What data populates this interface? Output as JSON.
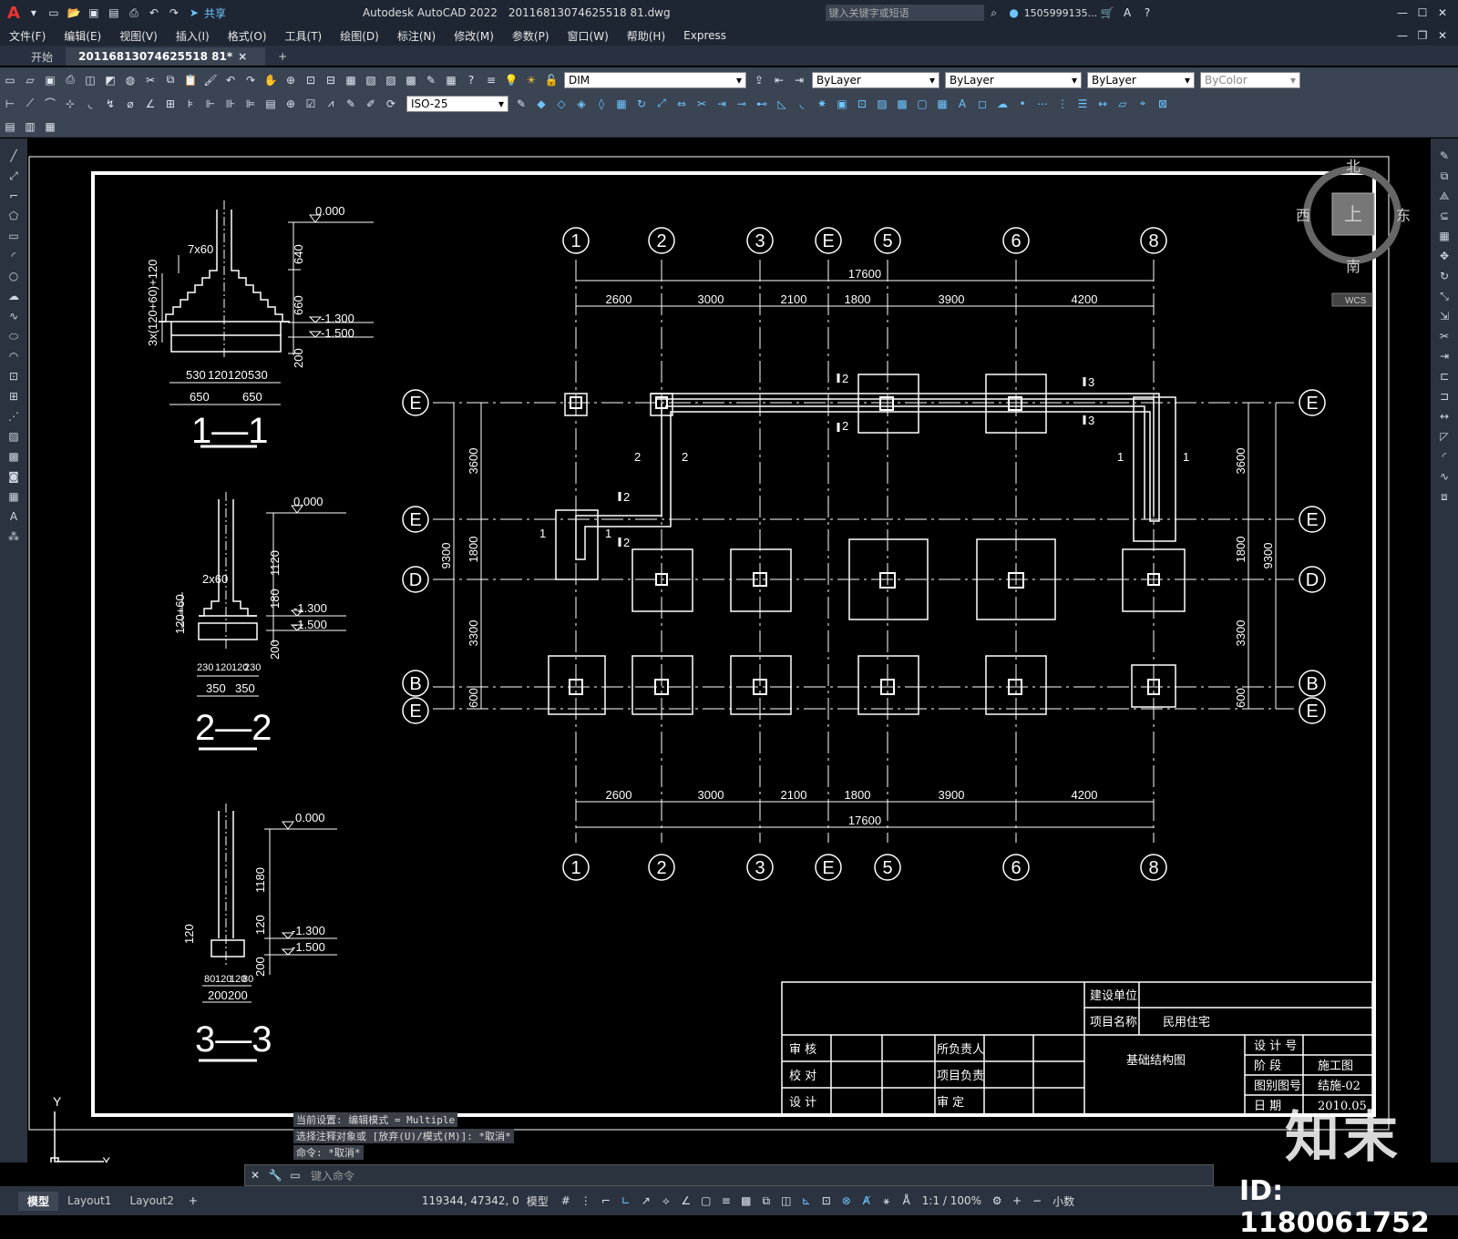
{
  "window": {
    "app_logo": "A",
    "title": "Autodesk AutoCAD 2022",
    "filename": "20116813074625518 81.dwg",
    "share_label": "共享",
    "search_placeholder": "键入关键字或短语",
    "user": "1505999135...",
    "colors": {
      "chrome": "#1e2633",
      "toolbar": "#3b4453",
      "canvas": "#000000"
    }
  },
  "menu": [
    "文件(F)",
    "编辑(E)",
    "视图(V)",
    "插入(I)",
    "格式(O)",
    "工具(T)",
    "绘图(D)",
    "标注(N)",
    "修改(M)",
    "参数(P)",
    "窗口(W)",
    "帮助(H)",
    "Express"
  ],
  "tabs": {
    "start": "开始",
    "doc": "20116813074625518 81*",
    "add": "+"
  },
  "toolbar": {
    "layer": "DIM",
    "color": "ByLayer",
    "linetype": "ByLayer",
    "lineweight": "ByLayer",
    "plotstyle": "ByColor",
    "dimstyle": "ISO-25"
  },
  "viewcube": {
    "north": "北",
    "south": "南",
    "east": "东",
    "west": "西",
    "top": "上",
    "wcs": "WCS"
  },
  "sections": [
    {
      "id": "1-1",
      "title": "1—1",
      "top_level": "0.000",
      "l1": "-1.300",
      "l2": "-1.500",
      "h1": "640",
      "h2": "660",
      "h3": "200",
      "step": "7x60",
      "side": "3x(120+60)+120",
      "w": [
        "530",
        "120",
        "120",
        "530"
      ],
      "half": [
        "650",
        "650"
      ]
    },
    {
      "id": "2-2",
      "title": "2—2",
      "top_level": "0.000",
      "l1": "-1.300",
      "l2": "-1.500",
      "h1": "1120",
      "h2": "180",
      "h3": "200",
      "step": "2x60",
      "side": "120+60",
      "w": [
        "230",
        "120",
        "120",
        "230"
      ],
      "half": [
        "350",
        "350"
      ]
    },
    {
      "id": "3-3",
      "title": "3—3",
      "top_level": "0.000",
      "l1": "-1.300",
      "l2": "-1.500",
      "h1": "1180",
      "h2": "120",
      "h3": "200",
      "side": "120",
      "w": [
        "80",
        "120",
        "120",
        "80"
      ],
      "half": [
        "200",
        "200"
      ]
    }
  ],
  "plan": {
    "axes_x": [
      "1",
      "2",
      "3",
      "E",
      "5",
      "6",
      "8"
    ],
    "axes_y": [
      "E",
      "E",
      "D",
      "B",
      "E"
    ],
    "dims_x": [
      "2600",
      "3000",
      "2100",
      "1800",
      "3900",
      "4200"
    ],
    "total_x": "17600",
    "dims_y_left": [
      "3600",
      "1800",
      "3300",
      "600"
    ],
    "total_y": "9300",
    "cut_labels": [
      "1",
      "2",
      "3"
    ]
  },
  "titleblock": {
    "jsdw": "建设单位",
    "xmmc": "项目名称",
    "xmmc_val": "民用住宅",
    "sh": "审 核",
    "jd": "校 对",
    "sj": "设 计",
    "sfzr": "所负责人",
    "xmfz": "项目负责",
    "sd": "审 定",
    "drawing_name": "基础结构图",
    "sjh": "设 计 号",
    "jieduan": "阶 段",
    "jieduan_val": "施工图",
    "tbth": "图别图号",
    "tbth_val": "结施-02",
    "riqi": "日 期",
    "riqi_val": "2010.05"
  },
  "ucs": {
    "x": "X",
    "y": "Y"
  },
  "command": {
    "line1": "当前设置: 编辑模式 = Multiple",
    "line2": "选择注释对象或 [放弃(U)/模式(M)]: *取消*",
    "line3": "命令: *取消*",
    "placeholder": "键入命令"
  },
  "status": {
    "tabs": [
      "模型",
      "Layout1",
      "Layout2"
    ],
    "coords": "119344, 47342, 0",
    "model": "模型",
    "scale": "1:1 / 100%",
    "units": "小数"
  },
  "watermark": {
    "id": "ID: 1180061752",
    "brand": "知末"
  }
}
